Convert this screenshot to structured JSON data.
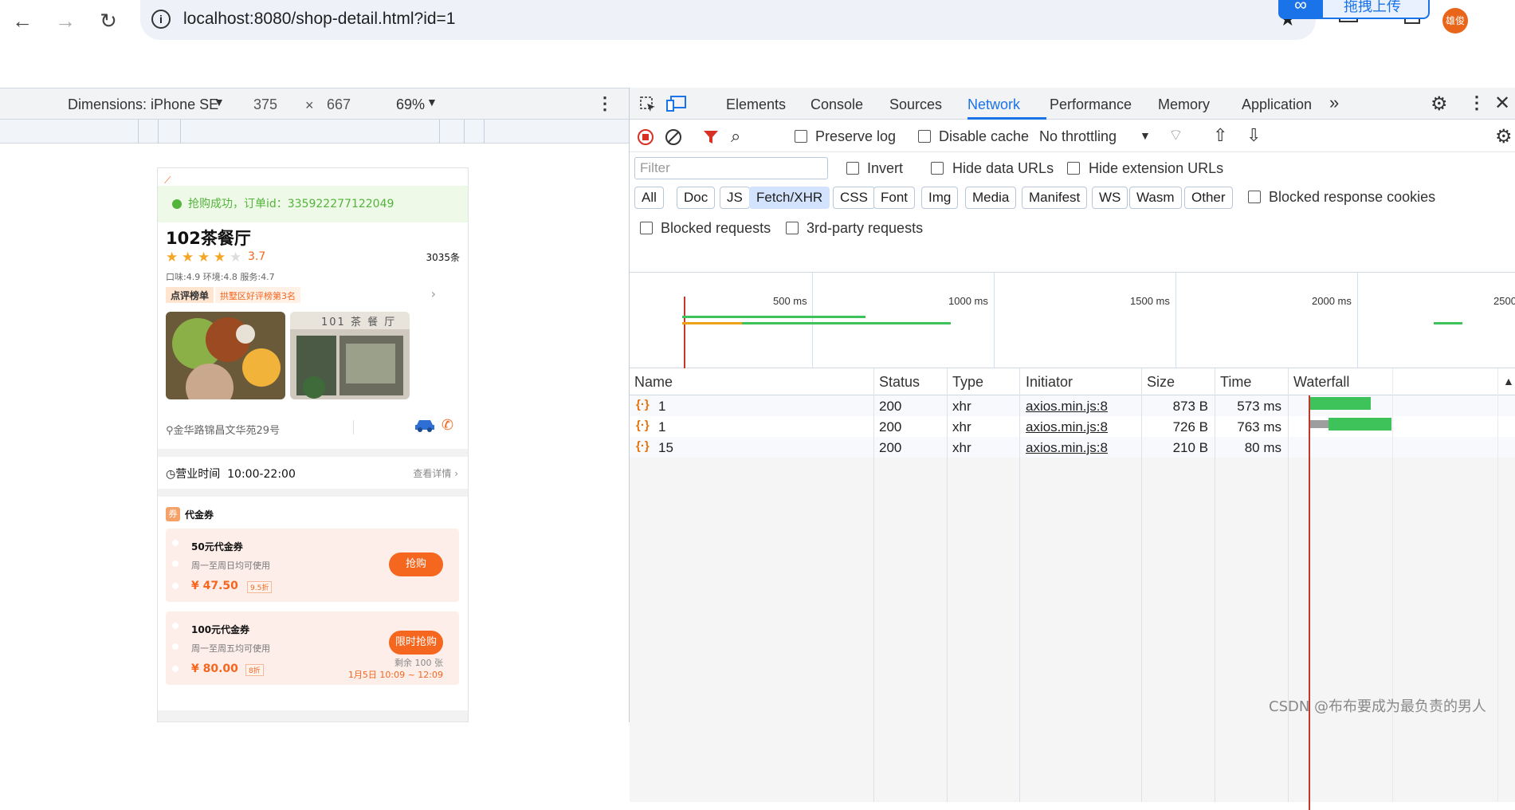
{
  "browser": {
    "url": "localhost:8080/shop-detail.html?id=1",
    "upload_label": "拖拽上传",
    "avatar_text": "雄俊"
  },
  "device_toolbar": {
    "dimensions_label": "Dimensions: iPhone SE",
    "width": "375",
    "times": "×",
    "height": "667",
    "zoom": "69%"
  },
  "shop": {
    "toast": "抢购成功，订单id：335922277122049",
    "name": "102茶餐厅",
    "stars": [
      "★",
      "★",
      "★",
      "★",
      "★"
    ],
    "score": "3.7",
    "reviews": "3035条",
    "subscores": "口味:4.9 环境:4.8 服务:4.7",
    "rank_tag": "点评榜单",
    "rank_text": "拱墅区好评榜第3名",
    "photo_sign": "101 茶 餐 厅",
    "address": "金华路锦昌文华苑29号",
    "hours_label": "营业时间",
    "hours_value": "10:00-22:00",
    "hours_more": "查看详情",
    "coupon_badge": "券",
    "coupon_section": "代金券",
    "coupons": [
      {
        "name": "50元代金券",
        "desc": "周一至周日均可使用",
        "price": "¥ 47.50",
        "discount": "9.5折",
        "button": "抢购"
      },
      {
        "name": "100元代金券",
        "desc": "周一至周五均可使用",
        "price": "¥ 80.00",
        "discount": "8折",
        "button": "限时抢购",
        "remain": "剩余 100 张",
        "time": "1月5日 10:09 ~ 12:09"
      }
    ]
  },
  "devtools": {
    "tabs": [
      "Elements",
      "Console",
      "Sources",
      "Network",
      "Performance",
      "Memory",
      "Application"
    ],
    "active_tab": "Network",
    "more_tabs": "»",
    "toolbar": {
      "preserve_log": "Preserve log",
      "disable_cache": "Disable cache",
      "throttling": "No throttling"
    },
    "filter": {
      "placeholder": "Filter",
      "invert": "Invert",
      "hide_data_urls": "Hide data URLs",
      "hide_extension_urls": "Hide extension URLs",
      "types": [
        "All",
        "Doc",
        "JS",
        "Fetch/XHR",
        "CSS",
        "Font",
        "Img",
        "Media",
        "Manifest",
        "WS",
        "Wasm",
        "Other"
      ],
      "active_type": "Fetch/XHR",
      "blocked_response_cookies": "Blocked response cookies",
      "blocked_requests": "Blocked requests",
      "third_party": "3rd-party requests"
    },
    "overview_ticks": [
      "500 ms",
      "1000 ms",
      "1500 ms",
      "2000 ms",
      "2500"
    ],
    "columns": [
      "Name",
      "Status",
      "Type",
      "Initiator",
      "Size",
      "Time",
      "Waterfall"
    ],
    "requests": [
      {
        "name": "1",
        "status": "200",
        "type": "xhr",
        "initiator": "axios.min.js:8",
        "size": "873 B",
        "time": "573 ms",
        "queue_ms": 0,
        "wait_ms": 573
      },
      {
        "name": "1",
        "status": "200",
        "type": "xhr",
        "initiator": "axios.min.js:8",
        "size": "726 B",
        "time": "763 ms",
        "queue_ms": 180,
        "wait_ms": 583
      },
      {
        "name": "15",
        "status": "200",
        "type": "xhr",
        "initiator": "axios.min.js:8",
        "size": "210 B",
        "time": "80 ms",
        "queue_ms": 0,
        "wait_ms": 80
      }
    ],
    "colors": {
      "accent": "#1a73e8",
      "wait": "#3ec35a",
      "queue": "#f0a11a",
      "stalled": "#9e9e9e"
    }
  },
  "watermark": "CSDN @布布要成为最负责的男人"
}
